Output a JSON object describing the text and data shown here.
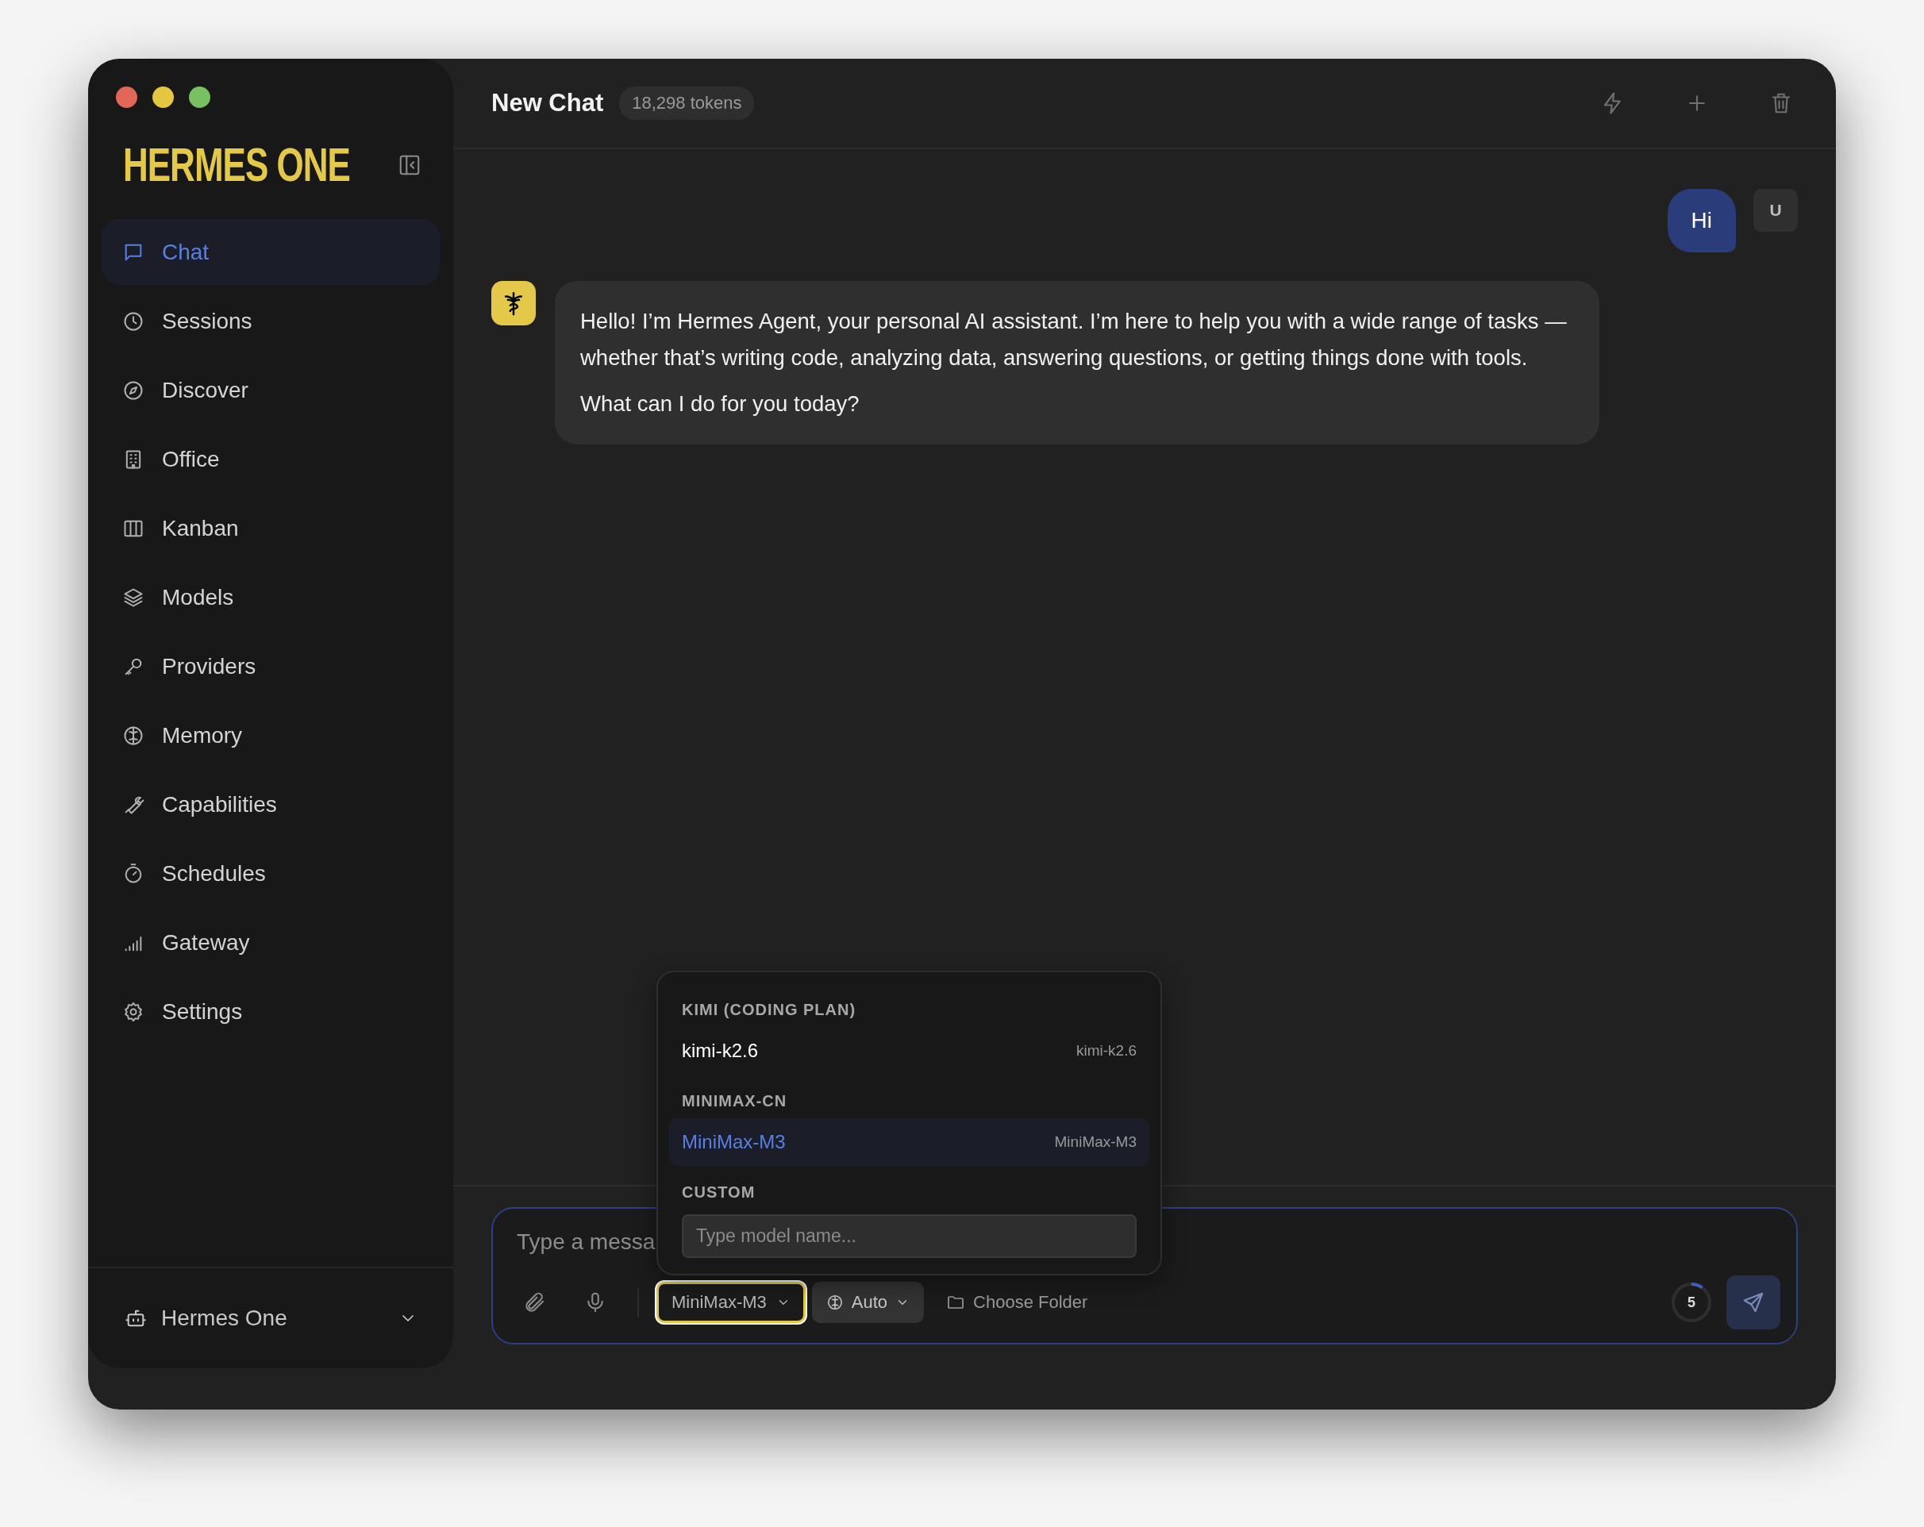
{
  "sidebar": {
    "logo": "HERMES ONE",
    "items": [
      {
        "label": "Chat",
        "selected": true
      },
      {
        "label": "Sessions",
        "selected": false
      },
      {
        "label": "Discover",
        "selected": false
      },
      {
        "label": "Office",
        "selected": false
      },
      {
        "label": "Kanban",
        "selected": false
      },
      {
        "label": "Models",
        "selected": false
      },
      {
        "label": "Providers",
        "selected": false
      },
      {
        "label": "Memory",
        "selected": false
      },
      {
        "label": "Capabilities",
        "selected": false
      },
      {
        "label": "Schedules",
        "selected": false
      },
      {
        "label": "Gateway",
        "selected": false
      },
      {
        "label": "Settings",
        "selected": false
      }
    ],
    "profile": {
      "name": "Hermes One"
    }
  },
  "header": {
    "title": "New Chat",
    "tokens": "18,298 tokens"
  },
  "messages": [
    {
      "kind": "user",
      "avatar": "U",
      "paragraphs": [
        "Hi"
      ]
    },
    {
      "kind": "assistant",
      "paragraphs": [
        "Hello! I’m Hermes Agent, your personal AI assistant. I’m here to help you with a wide range of tasks —whether that’s writing code, analyzing data, answering questions, or getting things done with tools.",
        "What can I do for you today?"
      ]
    }
  ],
  "composer": {
    "placeholder": "Type a messa",
    "model": {
      "label": "MiniMax-M3",
      "open": true
    },
    "mode": "Auto",
    "folder": "Choose Folder",
    "counter": {
      "value": "5",
      "level": 0.1
    }
  },
  "model_menu": {
    "groups": [
      {
        "title": "KIMI (CODING PLAN)",
        "models": [
          {
            "name": "kimi-k2.6",
            "id": "kimi-k2.6",
            "selected": false
          }
        ]
      },
      {
        "title": "MINIMAX-CN",
        "models": [
          {
            "name": "MiniMax-M3",
            "id": "MiniMax-M3",
            "selected": true
          }
        ]
      },
      {
        "title": "CUSTOM",
        "custom": {
          "placeholder": "Type model name..."
        }
      }
    ]
  }
}
